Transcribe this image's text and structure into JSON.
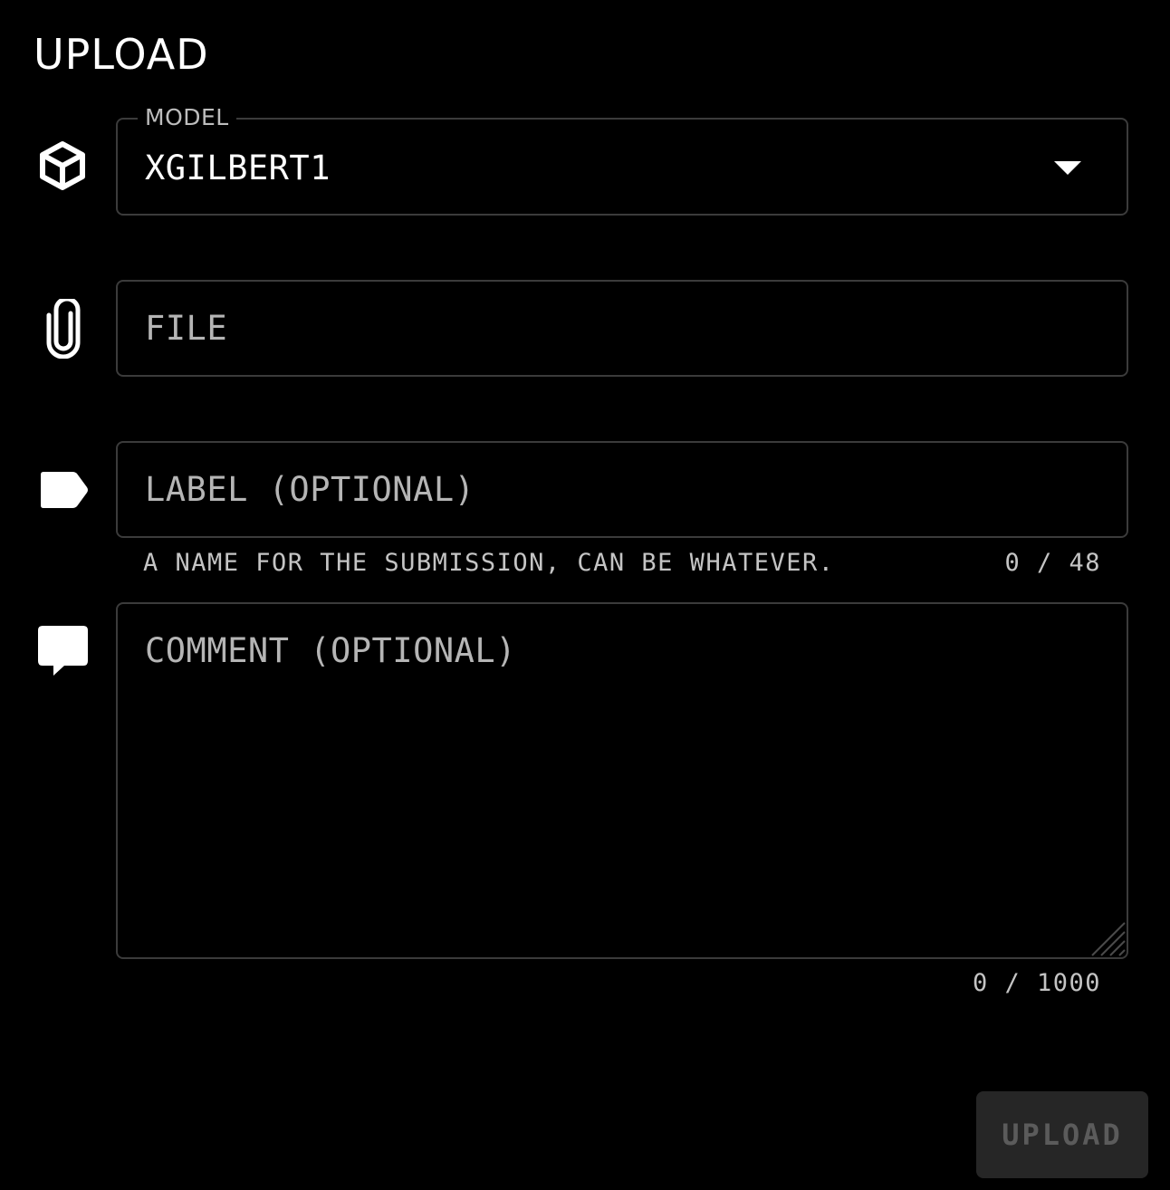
{
  "header": {
    "title": "UPLOAD"
  },
  "model_select": {
    "legend": "MODEL",
    "value": "XGILBERT1",
    "icon": "cube-icon",
    "caret_icon": "caret-down-icon"
  },
  "file_input": {
    "placeholder": "FILE",
    "icon": "paperclip-icon"
  },
  "label_input": {
    "placeholder": "LABEL (OPTIONAL)",
    "helper": "A NAME FOR THE SUBMISSION, CAN BE WHATEVER.",
    "counter": "0 / 48",
    "icon": "tag-icon"
  },
  "comment_input": {
    "placeholder": "COMMENT (OPTIONAL)",
    "counter": "0 / 1000",
    "icon": "comment-icon"
  },
  "actions": {
    "upload_label": "UPLOAD",
    "upload_enabled": false
  },
  "colors": {
    "background": "#000000",
    "border": "#3b3b3b",
    "placeholder": "#b5b5b5",
    "button_bg": "#262626",
    "button_text": "#5b5b5b"
  }
}
